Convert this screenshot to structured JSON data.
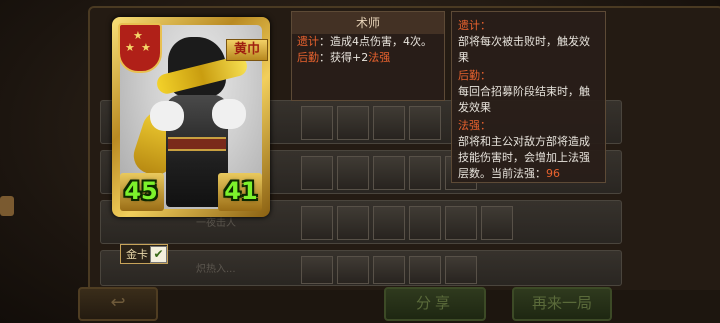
{
  "card": {
    "faction": "黄巾",
    "attack": "45",
    "health": "41",
    "gold_label": "金卡",
    "gold_check": "✔"
  },
  "board": {
    "back_label": "↩",
    "share_label": "分享",
    "again_label": "再来一局",
    "row_texts": [
      "一夜击人",
      "炽热入..."
    ]
  },
  "tooltip_unit": {
    "title": "术师",
    "lines": [
      {
        "key": "遗计",
        "sep": "：",
        "text": "造成4点伤害，4次。"
      },
      {
        "key": "后勤",
        "sep": "：",
        "text_pre": "获得+2",
        "highlight": "法强"
      }
    ]
  },
  "tooltip_keywords": {
    "items": [
      {
        "key": "遗计：",
        "desc": "部将每次被击败时，触发效果"
      },
      {
        "key": "后勤：",
        "desc": "每回合招募阶段结束时，触发效果"
      },
      {
        "key": "法强：",
        "desc": "部将和主公对敌方部将造成技能伤害时，会增加上法强层数。当前法强：",
        "value": "96"
      }
    ]
  },
  "colors": {
    "keyword": "#e8622e",
    "stat_green": "#7cf22c",
    "card_gold": "#d4a93a",
    "tooltip_bg": "#281e18"
  }
}
